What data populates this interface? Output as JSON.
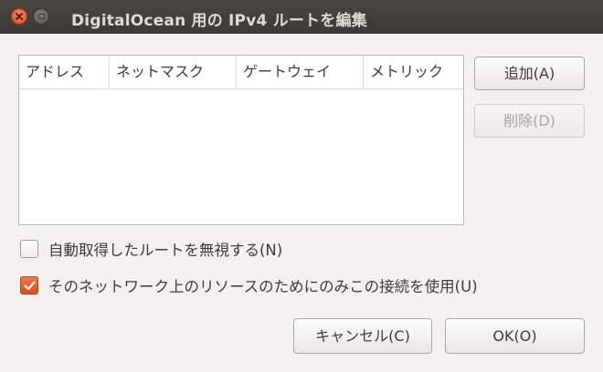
{
  "window": {
    "title": "DigitalOcean 用の IPv4 ルートを編集"
  },
  "table": {
    "columns": [
      "アドレス",
      "ネットマスク",
      "ゲートウェイ",
      "メトリック"
    ],
    "rows": []
  },
  "buttons": {
    "add": "追加(A)",
    "delete": "削除(D)",
    "cancel": "キャンセル(C)",
    "ok": "OK(O)"
  },
  "options": {
    "ignore_auto_routes": {
      "label": "自動取得したルートを無視する(N)",
      "checked": false
    },
    "use_only_for_resources": {
      "label": "そのネットワーク上のリソースのためにのみこの接続を使用(U)",
      "checked": true
    }
  },
  "colors": {
    "titlebar": "#3c3b37",
    "accent": "#dd4814",
    "close_button": "#df4b16"
  },
  "icons": {
    "close": "close-icon",
    "minimize": "minimize-icon",
    "check": "checkmark-icon"
  }
}
